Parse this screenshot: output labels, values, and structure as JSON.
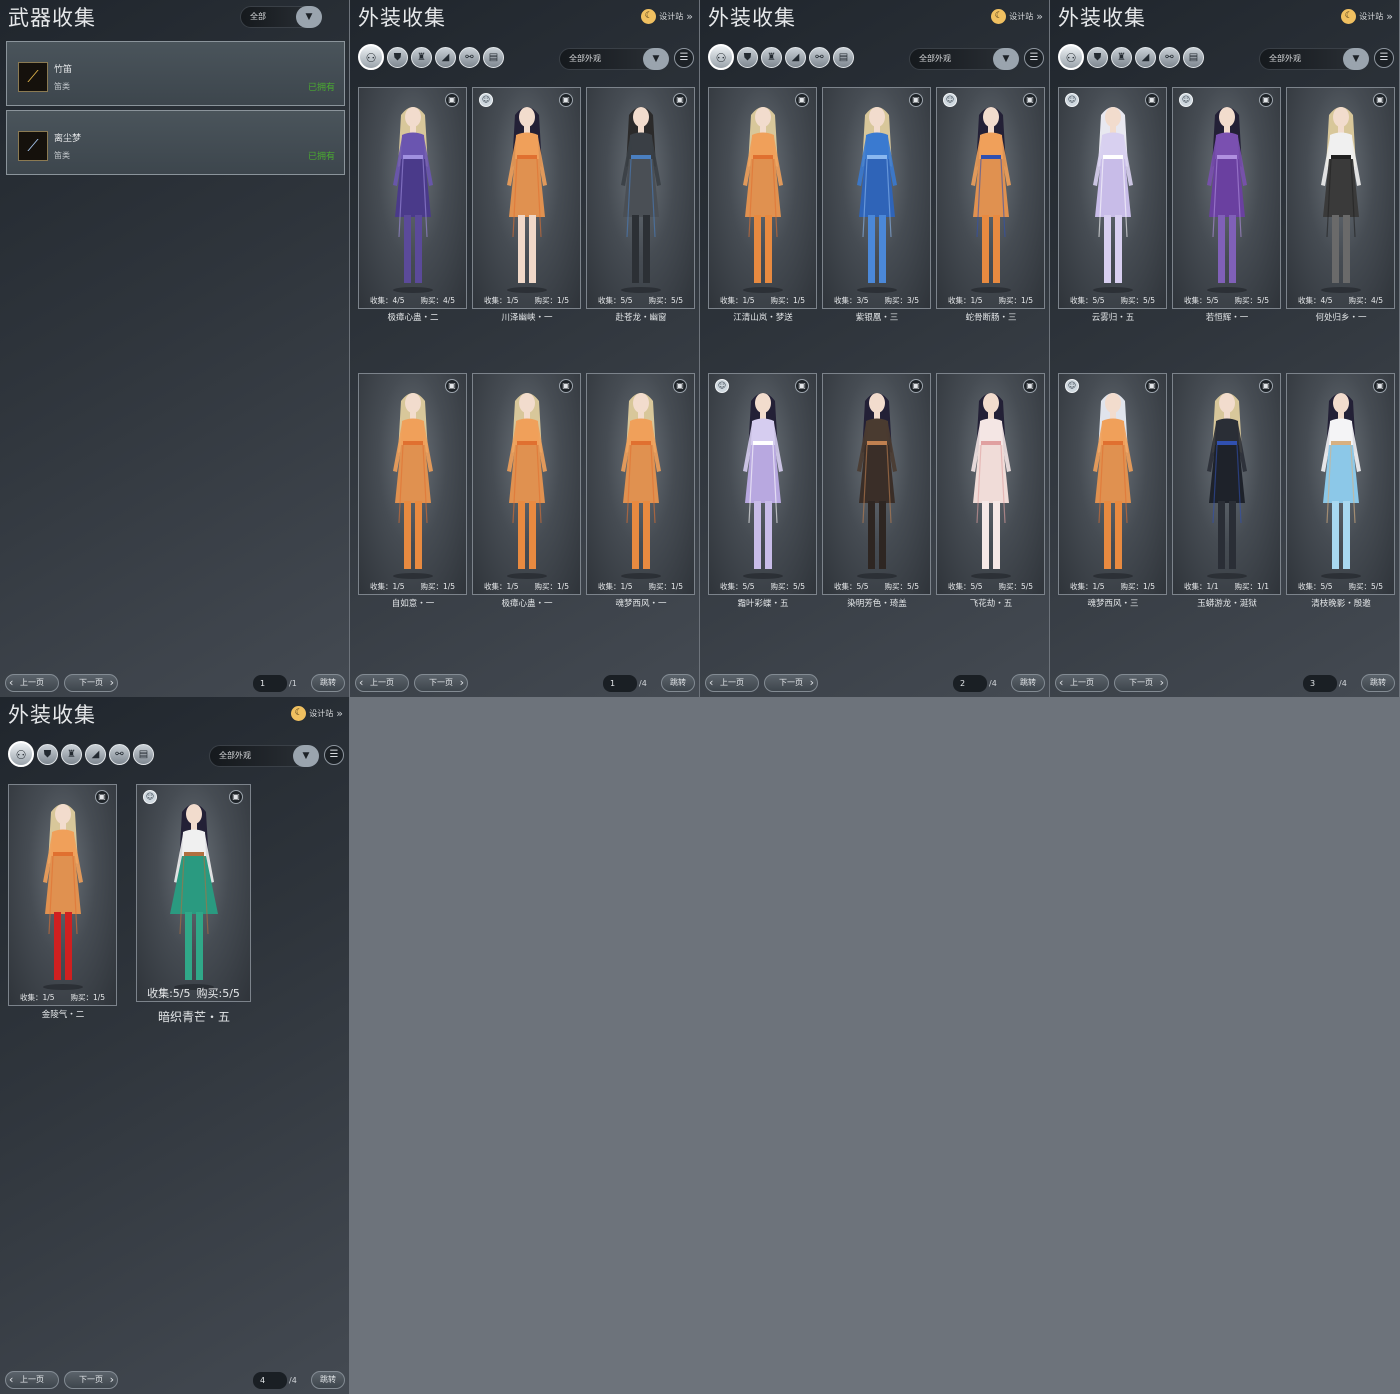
{
  "weapon_panel": {
    "title": "武器收集",
    "filter_value": "全部",
    "items": [
      {
        "name": "竹笛",
        "type": "笛类",
        "status": "已拥有"
      },
      {
        "name": "离尘梦",
        "type": "笛类",
        "status": "已拥有"
      }
    ],
    "pager": {
      "prev": "上一页",
      "next": "下一页",
      "current": "1",
      "total": "/1",
      "jump": "跳转"
    }
  },
  "outfit_common": {
    "title": "外装收集",
    "design_label": "设计站",
    "filter_value": "全部外观",
    "prev": "上一页",
    "next": "下一页",
    "jump": "跳转",
    "icons": [
      "all-outfits-icon",
      "top-icon",
      "bottoms-icon",
      "accessory-icon",
      "shoes-icon",
      "scroll-icon"
    ],
    "icon_glyphs": [
      "⚇",
      "⛊",
      "♜",
      "◢",
      "⚯",
      "▤"
    ]
  },
  "outfit_pages": [
    {
      "current": "1",
      "total": "/4",
      "cards": [
        {
          "name": "极瘴心蛊・二",
          "collect": "4/5",
          "buy": "4/5",
          "marker": "",
          "palette": {
            "hair": "#d8c79a",
            "top": "#6a55b0",
            "bottom": "#4a3a8a",
            "legs": "#5b4a9a",
            "accent": "#a090e0"
          }
        },
        {
          "name": "川泽幽峡・一",
          "collect": "1/5",
          "buy": "1/5",
          "marker": "mask",
          "palette": {
            "hair": "#232036",
            "top": "#f0a05a",
            "bottom": "#e09150",
            "legs": "#f0d8c8",
            "accent": "#e07030"
          }
        },
        {
          "name": "赴苍龙・幽窗",
          "collect": "5/5",
          "buy": "5/5",
          "marker": "",
          "palette": {
            "hair": "#2b2a2a",
            "top": "#3a3f45",
            "bottom": "#4a4f55",
            "legs": "#2c3035",
            "accent": "#4a7fc0"
          }
        },
        {
          "name": "自如意・一",
          "collect": "1/5",
          "buy": "1/5",
          "marker": "",
          "palette": {
            "hair": "#d8c79a",
            "top": "#f0a05a",
            "bottom": "#e09150",
            "legs": "#e88a40",
            "accent": "#e07030"
          }
        },
        {
          "name": "极瘴心蛊・一",
          "collect": "1/5",
          "buy": "1/5",
          "marker": "",
          "palette": {
            "hair": "#d8c79a",
            "top": "#f0a05a",
            "bottom": "#e09150",
            "legs": "#e88a40",
            "accent": "#e07030"
          }
        },
        {
          "name": "魂梦西风・一",
          "collect": "1/5",
          "buy": "1/5",
          "marker": "",
          "palette": {
            "hair": "#d8c79a",
            "top": "#f0a05a",
            "bottom": "#e09150",
            "legs": "#e88a40",
            "accent": "#e07030"
          }
        }
      ]
    },
    {
      "current": "2",
      "total": "/4",
      "cards": [
        {
          "name": "江清山岚・梦送",
          "collect": "1/5",
          "buy": "1/5",
          "marker": "",
          "palette": {
            "hair": "#d8c79a",
            "top": "#f0a05a",
            "bottom": "#e09150",
            "legs": "#e88a40",
            "accent": "#e07030"
          }
        },
        {
          "name": "紫银凰・三",
          "collect": "3/5",
          "buy": "3/5",
          "marker": "",
          "palette": {
            "hair": "#d8c79a",
            "top": "#3a7ad0",
            "bottom": "#2f64b8",
            "legs": "#4b88d8",
            "accent": "#8ab8f0"
          }
        },
        {
          "name": "蛇骨断肠・三",
          "collect": "1/5",
          "buy": "1/5",
          "marker": "mask",
          "palette": {
            "hair": "#232036",
            "top": "#f0a05a",
            "bottom": "#e09150",
            "legs": "#e88a40",
            "accent": "#3050b0"
          }
        },
        {
          "name": "霜叶彩蝶・五",
          "collect": "5/5",
          "buy": "5/5",
          "marker": "mask",
          "palette": {
            "hair": "#232036",
            "top": "#d6cdf0",
            "bottom": "#b8a8e0",
            "legs": "#c8bce8",
            "accent": "#ffffff"
          }
        },
        {
          "name": "染明芳色・琦盖",
          "collect": "5/5",
          "buy": "5/5",
          "marker": "",
          "palette": {
            "hair": "#232036",
            "top": "#4a3b30",
            "bottom": "#3a2e28",
            "legs": "#2e2622",
            "accent": "#c08050"
          }
        },
        {
          "name": "飞花劫・五",
          "collect": "5/5",
          "buy": "5/5",
          "marker": "",
          "palette": {
            "hair": "#232036",
            "top": "#f4e6e4",
            "bottom": "#f0dcd8",
            "legs": "#f5e8e6",
            "accent": "#e0a0a0"
          }
        }
      ]
    },
    {
      "current": "3",
      "total": "/4",
      "cards": [
        {
          "name": "云雾归・五",
          "collect": "5/5",
          "buy": "5/5",
          "marker": "mask",
          "palette": {
            "hair": "#e8e8f0",
            "top": "#d8d0f0",
            "bottom": "#c8bce8",
            "legs": "#d8cff0",
            "accent": "#ffffff"
          }
        },
        {
          "name": "若恒辉・一",
          "collect": "5/5",
          "buy": "5/5",
          "marker": "mask",
          "palette": {
            "hair": "#232036",
            "top": "#7a50b0",
            "bottom": "#6a40a0",
            "legs": "#8060b8",
            "accent": "#b090e0"
          }
        },
        {
          "name": "何处归乡・一",
          "collect": "4/5",
          "buy": "4/5",
          "marker": "",
          "palette": {
            "hair": "#d8c79a",
            "top": "#f0f0f0",
            "bottom": "#3a3a3a",
            "legs": "#6a6a6a",
            "accent": "#202020"
          }
        },
        {
          "name": "魂梦西风・三",
          "collect": "1/5",
          "buy": "1/5",
          "marker": "mask",
          "palette": {
            "hair": "#e0e4ec",
            "top": "#f0a05a",
            "bottom": "#e09150",
            "legs": "#e88a40",
            "accent": "#e07030"
          }
        },
        {
          "name": "玉蟒游龙・涎狱",
          "collect": "1/1",
          "buy": "1/1",
          "marker": "",
          "palette": {
            "hair": "#d8c79a",
            "top": "#2a2e36",
            "bottom": "#1e222a",
            "legs": "#2a2e36",
            "accent": "#3050b0"
          }
        },
        {
          "name": "清枝晚影・殷邀",
          "collect": "5/5",
          "buy": "5/5",
          "marker": "",
          "palette": {
            "hair": "#232036",
            "top": "#f4f4f6",
            "bottom": "#8cc8e8",
            "legs": "#a8d8f0",
            "accent": "#d8b080"
          }
        }
      ]
    },
    {
      "current": "4",
      "total": "/4",
      "cards": [
        {
          "name": "金陵气・二",
          "collect": "1/5",
          "buy": "1/5",
          "marker": "",
          "large": false,
          "palette": {
            "hair": "#d8c79a",
            "top": "#f0a05a",
            "bottom": "#e09150",
            "legs": "#d02020",
            "accent": "#e07030"
          }
        },
        {
          "name": "暗织青芒・五",
          "collect": "5/5",
          "buy": "5/5",
          "marker": "mask",
          "large": true,
          "palette": {
            "hair": "#232036",
            "top": "#f0f0f0",
            "bottom": "#2a9a80",
            "legs": "#30a888",
            "accent": "#b07040"
          }
        }
      ]
    }
  ]
}
